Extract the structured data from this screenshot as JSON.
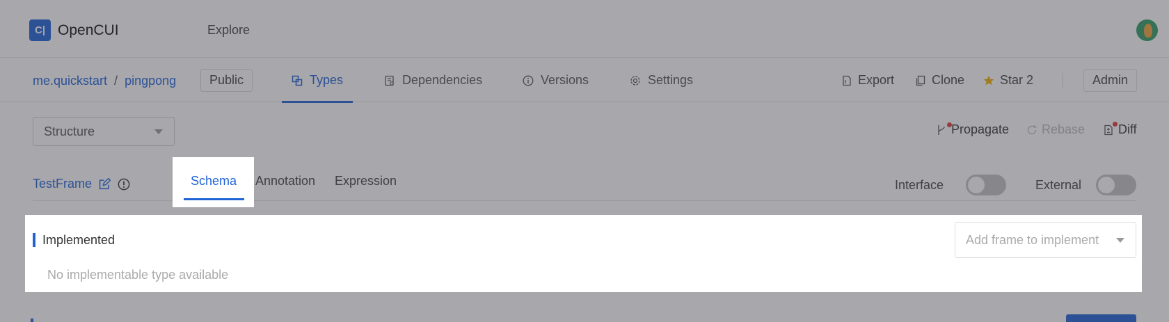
{
  "app": {
    "logo_glyph": "C|",
    "name": "OpenCUI",
    "explore": "Explore"
  },
  "breadcrumb": {
    "org": "me.quickstart",
    "separator": "/",
    "project": "pingpong"
  },
  "visibility": "Public",
  "nav_tabs": [
    {
      "label": "Types",
      "icon": "types-icon",
      "active": true
    },
    {
      "label": "Dependencies",
      "icon": "dependencies-icon",
      "active": false
    },
    {
      "label": "Versions",
      "icon": "versions-icon",
      "active": false
    },
    {
      "label": "Settings",
      "icon": "settings-icon",
      "active": false
    }
  ],
  "actions": {
    "export": "Export",
    "clone": "Clone",
    "star": "Star 2",
    "admin": "Admin"
  },
  "structure_select": {
    "value": "Structure"
  },
  "tools": {
    "propagate": "Propagate",
    "rebase": "Rebase",
    "diff": "Diff"
  },
  "frame": {
    "name": "TestFrame"
  },
  "subtabs": {
    "schema": "Schema",
    "annotation": "Annotation",
    "expression": "Expression"
  },
  "toggles": {
    "interface": "Interface",
    "external": "External",
    "interface_on": false,
    "external_on": false
  },
  "implemented": {
    "title": "Implemented",
    "empty_text": "No implementable type available",
    "add_placeholder": "Add frame to implement"
  },
  "colors": {
    "accent": "#1f63d6",
    "star": "#f5b000",
    "badge": "#e53935"
  }
}
